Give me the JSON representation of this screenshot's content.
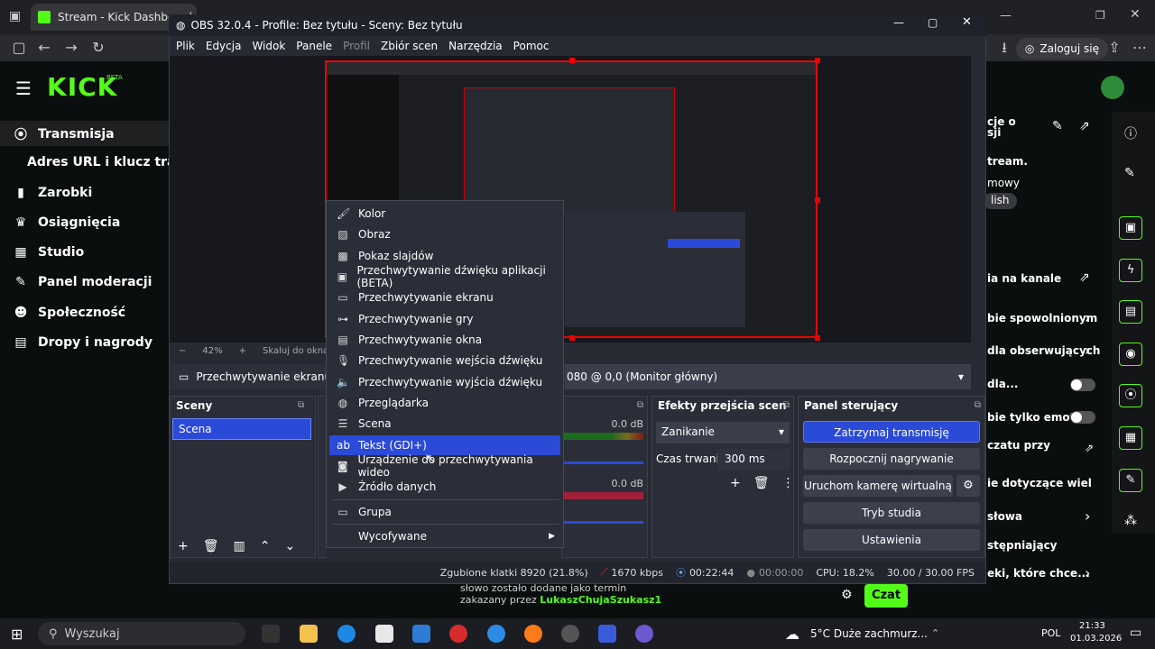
{
  "browser": {
    "tab_title": "Stream - Kick Dashboard",
    "login_label": "Zaloguj się"
  },
  "kick": {
    "logo": "KICK",
    "beta": "BETA",
    "sidebar": [
      {
        "label": "Transmisja",
        "icon": "broadcast-icon"
      },
      {
        "label": "Zarobki",
        "icon": "chart-icon"
      },
      {
        "label": "Osiągnięcia",
        "icon": "trophy-icon"
      },
      {
        "label": "Studio",
        "icon": "studio-icon"
      },
      {
        "label": "Panel moderacji",
        "icon": "wrench-icon"
      },
      {
        "label": "Społeczność",
        "icon": "people-icon"
      },
      {
        "label": "Dropy i nagrody",
        "icon": "gift-icon"
      }
    ],
    "sub_item": "Adres URL i klucz transm",
    "right": {
      "frag1": "cje o",
      "frag2": "sji",
      "frag3": "tream.",
      "frag4": "mowy",
      "lang_badge": "lish",
      "channel": "ia na kanale",
      "slowmode": "bie spowolnionym",
      "followers": "dla obserwujących",
      "dla": "dla...",
      "emotes": "bie tylko emotek",
      "chattime": "czatu przy",
      "rules": "ie dotyczące wiel",
      "words": "słowa",
      "stepping": "stępniający",
      "which": "eki, które chce..."
    },
    "chat_line1": "słowo zostało dodane jako termin",
    "chat_line2_prefix": "zakazany przez ",
    "chat_user": "LukaszChujaSzukasz1",
    "chat_button": "Czat"
  },
  "obs": {
    "title": "OBS 32.0.4 - Profile: Bez tytułu - Sceny: Bez tytułu",
    "menu": [
      "Plik",
      "Edycja",
      "Widok",
      "Panele",
      "Profil",
      "Zbiór scen",
      "Narzędzia",
      "Pomoc"
    ],
    "zoom": "42%",
    "fit_label": "Skaluj do okna",
    "source_name": "Przechwytywanie ekranu",
    "source_display": "080 @ 0,0 (Monitor główny)",
    "scenes_title": "Sceny",
    "scene_item": "Scena",
    "audio_db1": "0.0 dB",
    "audio_db2": "0.0 dB",
    "transitions_title": "Efekty przejścia scen",
    "transition_value": "Zanikanie",
    "duration_label": "Czas trwania",
    "duration_value": "300 ms",
    "controls_title": "Panel sterujący",
    "controls": [
      "Zatrzymaj transmisję",
      "Rozpocznij nagrywanie",
      "Uruchom kamerę wirtualną",
      "Tryb studia",
      "Ustawienia"
    ],
    "status": {
      "dropped": "Zgubione klatki 8920 (21.8%)",
      "bitrate": "1670 kbps",
      "live_time": "00:22:44",
      "rec_time": "00:00:00",
      "cpu": "CPU: 18.2%",
      "fps": "30.00 / 30.00 FPS"
    }
  },
  "context_menu": [
    {
      "label": "Kolor",
      "icon": "brush-icon"
    },
    {
      "label": "Obraz",
      "icon": "image-icon"
    },
    {
      "label": "Pokaz slajdów",
      "icon": "slideshow-icon"
    },
    {
      "label": "Przechwytywanie dźwięku aplikacji (BETA)",
      "icon": "app-audio-icon"
    },
    {
      "label": "Przechwytywanie ekranu",
      "icon": "monitor-icon"
    },
    {
      "label": "Przechwytywanie gry",
      "icon": "gamepad-icon"
    },
    {
      "label": "Przechwytywanie okna",
      "icon": "window-icon"
    },
    {
      "label": "Przechwytywanie wejścia dźwięku",
      "icon": "microphone-icon"
    },
    {
      "label": "Przechwytywanie wyjścia dźwięku",
      "icon": "speaker-icon"
    },
    {
      "label": "Przeglądarka",
      "icon": "globe-icon"
    },
    {
      "label": "Scena",
      "icon": "list-icon"
    },
    {
      "label": "Tekst (GDI+)",
      "icon": "text-icon"
    },
    {
      "label": "Urządzenie do przechwytywania wideo",
      "icon": "camera-icon"
    },
    {
      "label": "Źródło danych",
      "icon": "play-icon"
    },
    {
      "label": "Grupa",
      "icon": "folder-icon"
    },
    {
      "label": "Wycofywane",
      "icon": "submenu-arrow-icon"
    }
  ],
  "taskbar": {
    "search_placeholder": "Wyszukaj",
    "weather": "5°C  Duże zachmurz...",
    "lang": "POL",
    "time": "21:33",
    "date": "01.03.2026"
  }
}
